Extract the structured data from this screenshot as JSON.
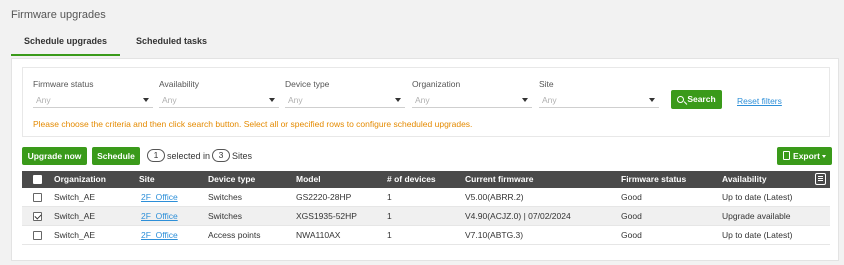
{
  "page": {
    "title": "Firmware upgrades"
  },
  "tabs": [
    {
      "label": "Schedule upgrades",
      "active": true
    },
    {
      "label": "Scheduled tasks",
      "active": false
    }
  ],
  "filters": {
    "firmware_status": {
      "label": "Firmware status",
      "placeholder": "Any"
    },
    "availability": {
      "label": "Availability",
      "placeholder": "Any"
    },
    "device_type": {
      "label": "Device type",
      "placeholder": "Any"
    },
    "organization": {
      "label": "Organization",
      "placeholder": "Any"
    },
    "site": {
      "label": "Site",
      "placeholder": "Any"
    },
    "search_label": "Search",
    "reset_label": "Reset filters",
    "hint": "Please choose the criteria and then click search button. Select all or specified rows to configure scheduled upgrades."
  },
  "toolbar": {
    "upgrade_now": "Upgrade now",
    "schedule": "Schedule",
    "selected_count": "1",
    "selected_in": "selected in",
    "sites_count": "3",
    "sites": "Sites",
    "export": "Export"
  },
  "table": {
    "headers": [
      "Organization",
      "Site",
      "Device type",
      "Model",
      "# of devices",
      "Current firmware",
      "Firmware status",
      "Availability"
    ],
    "rows": [
      {
        "checked": false,
        "organization": "Switch_AE",
        "site": "2F_Office",
        "device_type": "Switches",
        "model": "GS2220-28HP",
        "devices": "1",
        "firmware": "V5.00(ABRR.2)",
        "status": "Good",
        "availability": "Up to date (Latest)"
      },
      {
        "checked": true,
        "organization": "Switch_AE",
        "site": "2F_Office",
        "device_type": "Switches",
        "model": "XGS1935-52HP",
        "devices": "1",
        "firmware": "V4.90(ACJZ.0) | 07/02/2024",
        "status": "Good",
        "availability": "Upgrade available"
      },
      {
        "checked": false,
        "organization": "Switch_AE",
        "site": "2F_Office",
        "device_type": "Access points",
        "model": "NWA110AX",
        "devices": "1",
        "firmware": "V7.10(ABTG.3)",
        "status": "Good",
        "availability": "Up to date (Latest)"
      }
    ]
  },
  "colors": {
    "accent": "#3a9a1a",
    "link": "#2d8fd8",
    "hint": "#e48a00",
    "header_bg": "#4a4a4a"
  },
  "icons": {
    "search": "search-icon",
    "export": "document-icon",
    "columns": "column-settings-icon"
  }
}
